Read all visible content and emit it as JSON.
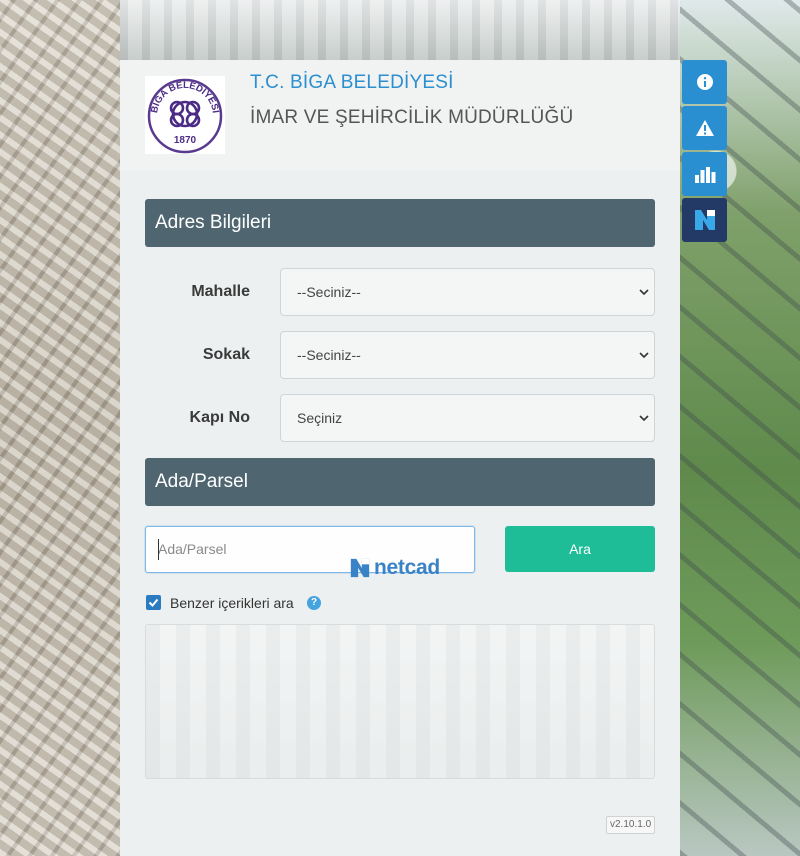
{
  "header": {
    "org_title": "T.C. BİGA BELEDİYESİ",
    "department": "İMAR VE ŞEHİRCİLİK MÜDÜRLÜĞÜ",
    "logo": {
      "arc_text": "BİGA BELEDİYESİ",
      "year": "1870"
    }
  },
  "side_toolbar": [
    {
      "icon": "info-icon"
    },
    {
      "icon": "warning-icon"
    },
    {
      "icon": "bar-chart-icon"
    },
    {
      "icon": "netcad-logo-icon"
    }
  ],
  "address_section": {
    "title": "Adres Bilgileri",
    "fields": [
      {
        "label": "Mahalle",
        "value": "--Seciniz--"
      },
      {
        "label": "Sokak",
        "value": "--Seciniz--"
      },
      {
        "label": "Kapı No",
        "value": "Seçiniz"
      }
    ]
  },
  "parcel_section": {
    "title": "Ada/Parsel",
    "input_placeholder": "Ada/Parsel",
    "search_button": "Ara",
    "brand": "netcad"
  },
  "similar": {
    "label": "Benzer içerikleri ara",
    "checked": true
  },
  "version": "v2.10.1.0",
  "colors": {
    "accent_blue": "#2b8fd0",
    "section_bar": "#4f6670",
    "search_button": "#1fbd97",
    "side_dark": "#233a66"
  }
}
